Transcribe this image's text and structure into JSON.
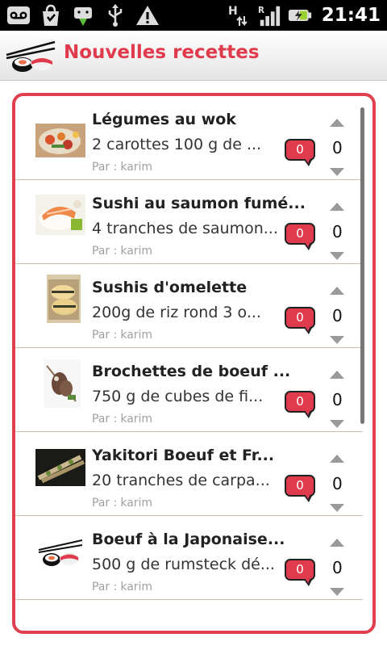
{
  "status_bar": {
    "time": "21:41",
    "left_icons": [
      "voicemail-icon",
      "shopping-bag-icon",
      "android-download-icon",
      "usb-icon",
      "warning-icon"
    ],
    "right_icons": [
      "hsdpa-data-icon",
      "roaming-signal-icon",
      "battery-charging-icon"
    ]
  },
  "header": {
    "title": "Nouvelles recettes",
    "accent_color": "#e03b4c"
  },
  "recipes": [
    {
      "title": "Légumes au wok",
      "description": "2 carottes 100 g de ...",
      "author_label": "Par :",
      "author": "karim",
      "comments": "0",
      "votes": "0"
    },
    {
      "title": "Sushi au saumon fumé...",
      "description": "4 tranches de saumon...",
      "author_label": "Par :",
      "author": "karim",
      "comments": "0",
      "votes": "0"
    },
    {
      "title": "Sushis d'omelette",
      "description": "200g de riz rond 3 o...",
      "author_label": "Par :",
      "author": "karim",
      "comments": "0",
      "votes": "0"
    },
    {
      "title": "Brochettes de boeuf ...",
      "description": "750 g de cubes de fi...",
      "author_label": "Par :",
      "author": "karim",
      "comments": "0",
      "votes": "0"
    },
    {
      "title": "Yakitori Boeuf et Fr...",
      "description": "20 tranches de carpa...",
      "author_label": "Par :",
      "author": "karim",
      "comments": "0",
      "votes": "0"
    },
    {
      "title": "Boeuf à la Japonaise...",
      "description": "500 g de rumsteck dé...",
      "author_label": "Par :",
      "author": "karim",
      "comments": "0",
      "votes": "0"
    }
  ]
}
